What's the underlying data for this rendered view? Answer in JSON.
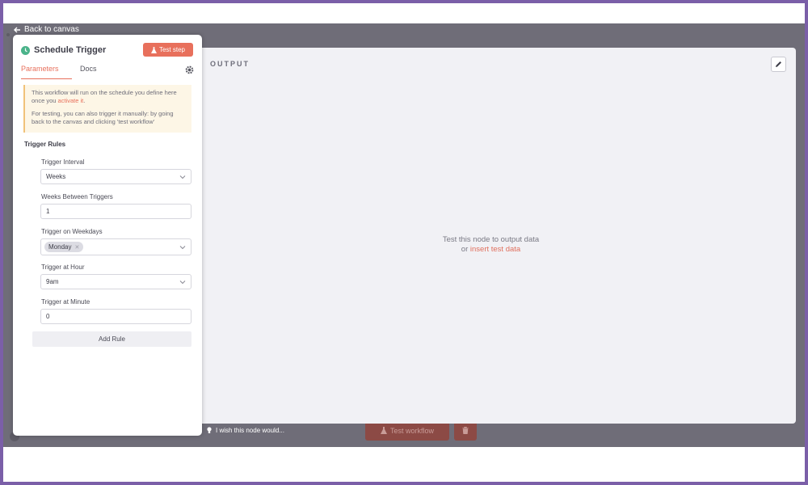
{
  "nav": {
    "back_label": "Back to canvas"
  },
  "node": {
    "title": "Schedule Trigger",
    "test_step_label": "Test step",
    "tabs": [
      {
        "label": "Parameters",
        "active": true
      },
      {
        "label": "Docs",
        "active": false
      }
    ],
    "notice": {
      "line1_pre": "This workflow will run on the schedule you define here once you ",
      "line1_link": "activate it",
      "line1_post": ".",
      "line2": "For testing, you can also trigger it manually: by going back to the canvas and clicking 'test workflow'"
    },
    "trigger_rules_title": "Trigger Rules",
    "fields": {
      "trigger_interval": {
        "label": "Trigger Interval",
        "value": "Weeks"
      },
      "weeks_between": {
        "label": "Weeks Between Triggers",
        "value": "1"
      },
      "weekdays": {
        "label": "Trigger on Weekdays",
        "chips": [
          "Monday"
        ]
      },
      "hour": {
        "label": "Trigger at Hour",
        "value": "9am"
      },
      "minute": {
        "label": "Trigger at Minute",
        "value": "0"
      }
    },
    "add_rule_label": "Add Rule"
  },
  "output": {
    "title": "OUTPUT",
    "empty_line1": "Test this node to output data",
    "empty_or": "or ",
    "empty_link": "insert test data",
    "feedback": "I wish this node would..."
  },
  "canvas": {
    "test_workflow_label": "Test workflow"
  },
  "colors": {
    "accent": "#e8705c",
    "trigger_icon": "#4bb38a",
    "frame_border": "#7b5fa8"
  },
  "icons": [
    "arrow-left-icon",
    "clock-icon",
    "flask-icon",
    "gear-icon",
    "chevron-down-icon",
    "pencil-icon",
    "lightbulb-icon",
    "trash-icon",
    "close-icon"
  ]
}
